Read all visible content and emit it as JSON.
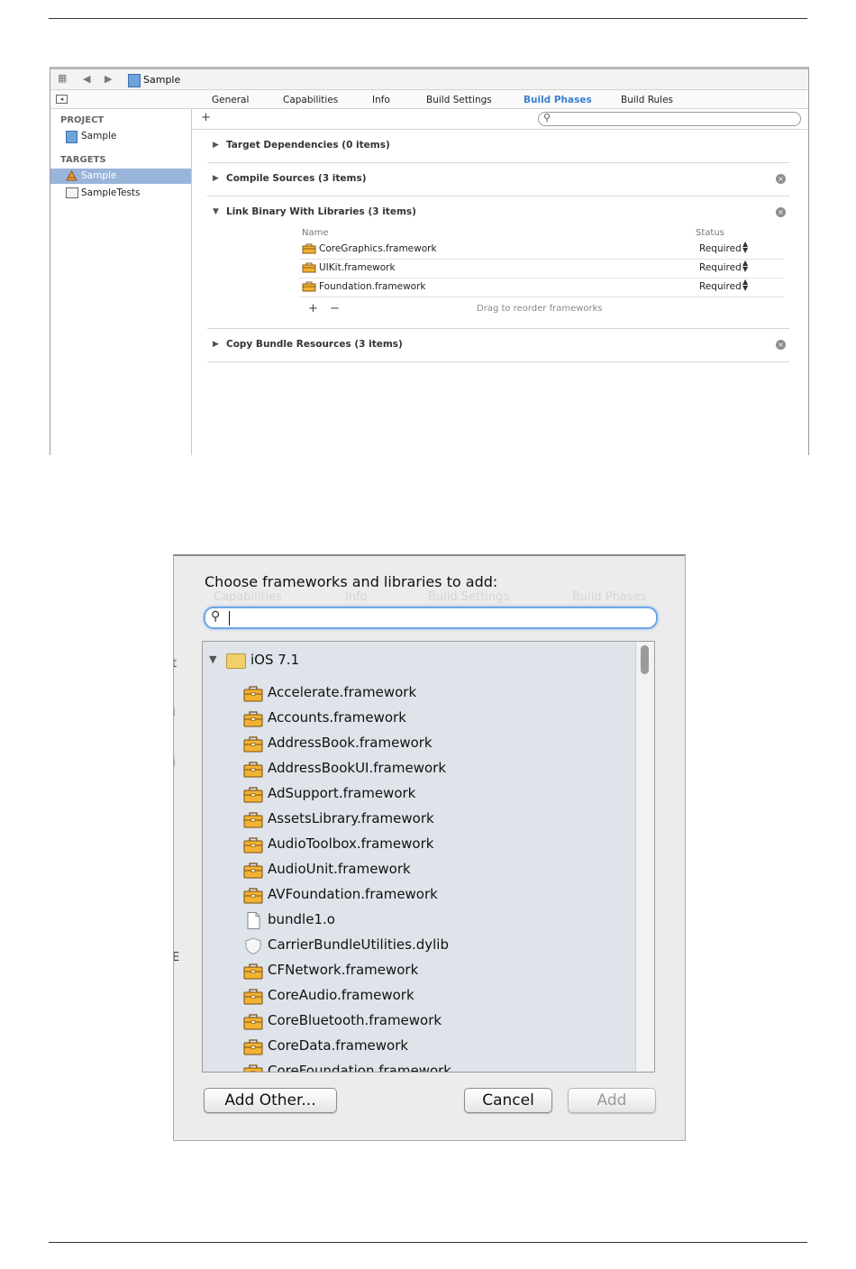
{
  "xcode": {
    "jumpbar": {
      "grid_icon": "grid-icon",
      "back_arrow": "◀",
      "forward_arrow": "▶",
      "title": "Sample"
    },
    "tabs": [
      {
        "label": "General"
      },
      {
        "label": "Capabilities"
      },
      {
        "label": "Info"
      },
      {
        "label": "Build Settings"
      },
      {
        "label": "Build Phases",
        "active": true
      },
      {
        "label": "Build Rules"
      }
    ],
    "sidebar": {
      "project_header": "PROJECT",
      "project_item": "Sample",
      "targets_header": "TARGETS",
      "targets": [
        {
          "label": "Sample",
          "selected": true
        },
        {
          "label": "SampleTests",
          "selected": false
        }
      ]
    },
    "toolbar": {
      "add": "+",
      "search_icon": "magnifier-icon"
    },
    "phases": [
      {
        "title": "Target Dependencies (0 items)",
        "expanded": false
      },
      {
        "title": "Compile Sources (3 items)",
        "expanded": false
      },
      {
        "title": "Link Binary With Libraries (3 items)",
        "expanded": true
      },
      {
        "title": "Copy Bundle Resources (3 items)",
        "expanded": false
      }
    ],
    "arrows": {
      "collapsed": "▶",
      "expanded": "▼",
      "close": "×",
      "updown": "▲▼"
    },
    "libraries": {
      "name_header": "Name",
      "status_header": "Status",
      "rows": [
        {
          "name": "CoreGraphics.framework",
          "status": "Required"
        },
        {
          "name": "UIKit.framework",
          "status": "Required"
        },
        {
          "name": "Foundation.framework",
          "status": "Required"
        }
      ],
      "add": "+",
      "remove": "−",
      "hint": "Drag to reorder frameworks"
    }
  },
  "dialog": {
    "title": "Choose frameworks and libraries to add:",
    "search_value": "",
    "group": "iOS 7.1",
    "items": [
      {
        "name": "Accelerate.framework",
        "kind": "framework"
      },
      {
        "name": "Accounts.framework",
        "kind": "framework"
      },
      {
        "name": "AddressBook.framework",
        "kind": "framework"
      },
      {
        "name": "AddressBookUI.framework",
        "kind": "framework"
      },
      {
        "name": "AdSupport.framework",
        "kind": "framework"
      },
      {
        "name": "AssetsLibrary.framework",
        "kind": "framework"
      },
      {
        "name": "AudioToolbox.framework",
        "kind": "framework"
      },
      {
        "name": "AudioUnit.framework",
        "kind": "framework"
      },
      {
        "name": "AVFoundation.framework",
        "kind": "framework"
      },
      {
        "name": "bundle1.o",
        "kind": "file"
      },
      {
        "name": "CarrierBundleUtilities.dylib",
        "kind": "dylib"
      },
      {
        "name": "CFNetwork.framework",
        "kind": "framework"
      },
      {
        "name": "CoreAudio.framework",
        "kind": "framework"
      },
      {
        "name": "CoreBluetooth.framework",
        "kind": "framework"
      },
      {
        "name": "CoreData.framework",
        "kind": "framework"
      },
      {
        "name": "CoreFoundation.framework",
        "kind": "framework"
      }
    ],
    "buttons": {
      "add_other": "Add Other...",
      "cancel": "Cancel",
      "add": "Add"
    },
    "background_ghost": {
      "tabs": [
        "Capabilities",
        "Info",
        "Build Settings",
        "Build Phases"
      ],
      "letters": [
        "t",
        "i",
        "i",
        "E"
      ]
    }
  },
  "colors": {
    "accent": "#3b7fd0",
    "selection": "#9ab5da",
    "list_bg": "#dfe3ea",
    "focus_ring": "#6fa6e6"
  }
}
